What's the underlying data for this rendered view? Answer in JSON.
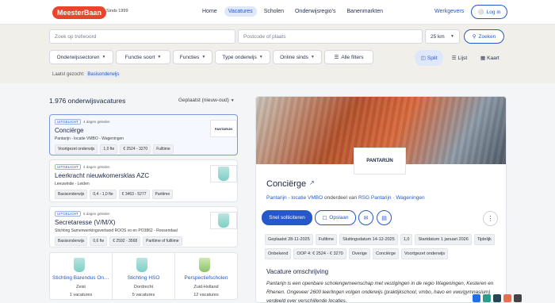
{
  "header": {
    "logo": "MeesterBaan",
    "since": "Sinds 1999",
    "nav": [
      "Home",
      "Vacatures",
      "Scholen",
      "Onderwijsregio's",
      "Banenmarkten"
    ],
    "nav_active": 1,
    "werkgevers": "Werkgevers",
    "login": "Log in"
  },
  "search": {
    "keyword_placeholder": "Zoek op trefwoord",
    "location_placeholder": "Postcode of plaats",
    "radius": "25 km",
    "submit": "Zoeken",
    "filters": [
      "Onderwijssectoren",
      "Functie soort",
      "Functies",
      "Type onderwijs",
      "Online sinds",
      "Alle filters"
    ],
    "views": [
      "Split",
      "Lijst",
      "Kaart"
    ],
    "view_active": 0,
    "last_search_label": "Laatst gezocht:",
    "last_search_value": "Basisonderwijs"
  },
  "results": {
    "count": "1.976 onderwijsvacatures",
    "sort": "Geplaatst (nieuw-oud)",
    "jobs": [
      {
        "badge": "UITGELICHT",
        "age": "4 dagen geleden",
        "title": "Conciërge",
        "org": "Pantarijn - locatie VMBO - Wageningen",
        "chips": [
          "Voortgezet onderwijs",
          "1,0 fte",
          "€ 2524 - 3270",
          "Fulltime"
        ],
        "logo": "PANTARIJN"
      },
      {
        "badge": "UITGELICHT",
        "age": "4 dagen geleden",
        "title": "Leerkracht nieuwkomersklas AZC",
        "org": "Leeuwinde - Leiden",
        "chips": [
          "Basisonderwijs",
          "0,4 - 1,0 fte",
          "€ 3463 - 5277",
          "Parttime"
        ],
        "logo": ""
      },
      {
        "badge": "UITGELICHT",
        "age": "5 dagen geleden",
        "title": "Secretaresse (V/M/X)",
        "org": "Stichting Samenwerkingsverband ROOS vo en PO3862 - Roosendaal",
        "chips": [
          "Basisonderwijs",
          "0,6 fte",
          "€ 2592 - 3568",
          "Parttime of fulltime"
        ],
        "logo": ""
      }
    ],
    "schools": [
      {
        "name": "Stichting Barendus Ond…",
        "location": "Zeist",
        "count": "1 vacatures"
      },
      {
        "name": "Stichting HSO",
        "location": "Dordrecht",
        "count": "5 vacatures"
      },
      {
        "name": "Perspectiefscholen",
        "location": "Zuid-Holland",
        "count": "12 vacatures"
      }
    ]
  },
  "detail": {
    "logo": "PANTARIJN",
    "title": "Conciërge",
    "org_link": "Pantarijn - locatie VMBO",
    "sub_mid": " onderdeel van ",
    "parent_link": "RSG Pantarijn",
    "sub_sep": " · ",
    "city_link": "Wageningen",
    "apply": "Snel solliciteren",
    "save": "Opslaan",
    "chips_row1": [
      "Geplaatst 28-11-2025",
      "Fulltime",
      "Sluitingsdatum 14-12-2025",
      "1,0",
      "Startdatum 1 januari 2026",
      "Tijdelijk"
    ],
    "chips_row2": [
      "Onbekend",
      "OOP 4: € 2524 - € 3270",
      "Overige",
      "Conciërge",
      "Voortgezet onderwijs"
    ],
    "vacature_heading": "Vacature omschrijving",
    "vacature_text": "Pantarijn is een openbare scholengemeenschap met vestigingen in de regio Wageningen, Kesteren en Rhenen. Ongeveer 2600 leerlingen volgen onderwijs (praktijkschool, vmbo, havo en vwo/gymnasium) verdeeld over verschillende locaties."
  },
  "colors": {
    "brand": "#e8452c",
    "accent": "#2658c9"
  }
}
